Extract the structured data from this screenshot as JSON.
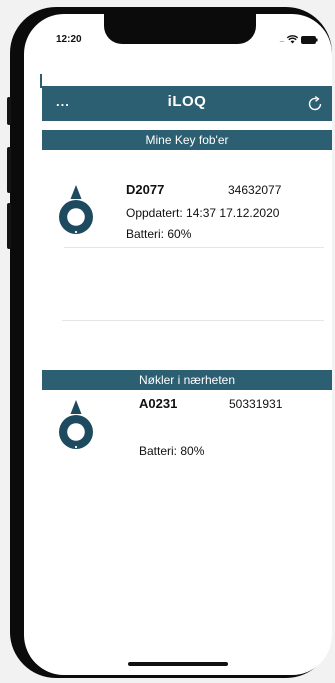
{
  "status_bar": {
    "time": "12:20"
  },
  "app_bar": {
    "menu_label": "...",
    "logo_text": "iLOQ"
  },
  "my_fobs": {
    "header": "Mine Key fob'er",
    "items": [
      {
        "id": "D2077",
        "serial": "34632077",
        "updated": "Oppdatert: 14:37 17.12.2020",
        "battery": "Batteri: 60%"
      }
    ]
  },
  "nearby": {
    "header": "Nøkler i nærheten",
    "items": [
      {
        "id": "A0231",
        "serial": "50331931",
        "battery": "Batteri: 80%"
      }
    ]
  },
  "colors": {
    "accent": "#2d5f73",
    "fob": "#1d4a5e"
  },
  "icons": {
    "refresh": "refresh-icon",
    "fob": "key-fob-icon",
    "wifi": "wifi-icon",
    "battery": "battery-icon"
  }
}
